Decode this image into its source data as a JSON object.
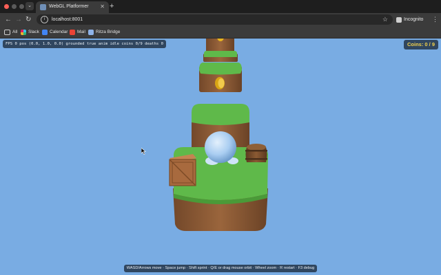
{
  "browser": {
    "tab_title": "WebGL Platformer",
    "url": "localhost:8001",
    "incognito_label": "Incognito",
    "bookmarks": [
      {
        "label": "All",
        "icon": "folder-icon",
        "color": "#cfcfcf"
      },
      {
        "label": "Slack",
        "icon": "slack-icon",
        "color": "#e01e5a"
      },
      {
        "label": "Calendar",
        "icon": "calendar-icon",
        "color": "#4285f4"
      },
      {
        "label": "Mail",
        "icon": "gmail-icon",
        "color": "#ea4335"
      },
      {
        "label": "Ritza Bridge",
        "icon": "bridge-icon",
        "color": "#8fb3e8"
      }
    ]
  },
  "hud": {
    "debug": "FPS 0  pos (0.0, 1.0, 0.0)  grounded true  anim idle  coins 0/9  deaths 0",
    "coins": "Coins: 0 / 9",
    "help": "WASD/Arrows move · Space jump · Shift sprint · Q/E or drag mouse orbit · Wheel zoom · R restart · F3 debug"
  },
  "colors": {
    "sky": "#79ace3",
    "grass": "#5fb94a",
    "dirt": "#8a5a36",
    "coin": "#e8b51f",
    "player": "#a9cdf1",
    "crate": "#a86a3e",
    "barrel": "#7a4e2c",
    "hud_accent": "#f3d24b"
  }
}
